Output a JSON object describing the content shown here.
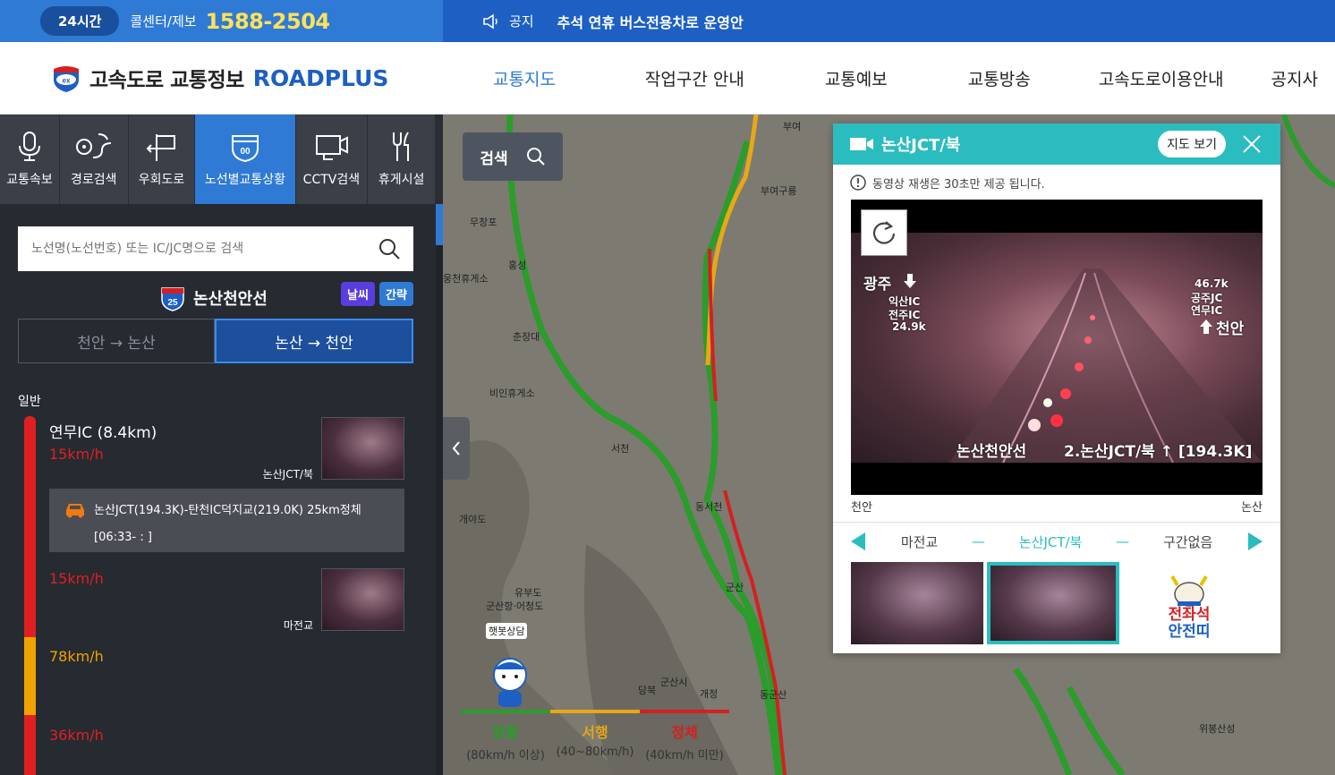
{
  "topbar": {
    "badge": "24시간",
    "callcenter_label": "콜센터/제보",
    "phone": "1588-2504",
    "notice_label": "공지",
    "notice_text": "추석 연휴 버스전용차로 운영안"
  },
  "header": {
    "logo_text": "고속도로 교통정보",
    "logo_brand": "ROADPLUS",
    "logo_badge": "ex",
    "nav": [
      "교통지도",
      "작업구간 안내",
      "교통예보",
      "교통방송",
      "고속도로이용안내",
      "공지사"
    ],
    "active_nav": "교통지도",
    "colors": {
      "brand": "#1d5fc3",
      "accent": "#2f7ad4",
      "teal": "#2bbcc0"
    }
  },
  "sidebar": {
    "icons": [
      {
        "label": "교통속보",
        "icon": "microphone-icon"
      },
      {
        "label": "경로검색",
        "icon": "route-icon"
      },
      {
        "label": "우회도로",
        "icon": "detour-icon"
      },
      {
        "label": "노선별교통상황",
        "icon": "highway-shield-icon",
        "active": true
      },
      {
        "label": "CCTV검색",
        "icon": "cctv-icon"
      },
      {
        "label": "휴게시설",
        "icon": "restaurant-icon"
      }
    ],
    "search_placeholder": "노선명(노선번호) 또는 IC/JC명으로 검색",
    "route_number": "25",
    "route_name": "논산천안선",
    "weather_chip": "날씨",
    "brief_chip": "간략",
    "directions": [
      "천안 → 논산",
      "논산 → 천안"
    ],
    "active_direction": "논산 → 천안",
    "section_label": "일반",
    "segments": [
      {
        "ic": "연무IC (8.4km)",
        "speed": "15km/h",
        "status": "congested",
        "cctv_label": "논산JCT/북"
      },
      {
        "ic": "",
        "speed": "15km/h",
        "status": "congested",
        "cctv_label": "마전교"
      },
      {
        "ic": "",
        "speed": "78km/h",
        "status": "slow",
        "cctv_label": ""
      },
      {
        "ic": "",
        "speed": "36km/h",
        "status": "congested",
        "cctv_label": ""
      }
    ],
    "incident": {
      "icon": "car-accident-icon",
      "text": "논산JCT(194.3K)-탄천IC덕지교(219.0K) 25km정체",
      "time": "[06:33- : ]"
    }
  },
  "map": {
    "search_label": "검색",
    "labels": [
      "부여",
      "부여구룡",
      "무창포",
      "웅천휴게소",
      "홍성",
      "춘장대",
      "비인휴게소",
      "서천",
      "동서천",
      "개야도",
      "유부도",
      "군산항·어청도",
      "군산",
      "동군산",
      "당북",
      "군산시",
      "개정",
      "햇봇상담",
      "천안",
      "위봉산성"
    ],
    "legend": [
      {
        "name": "원활",
        "range": "(80km/h 이상)",
        "color": "#2a9d2a"
      },
      {
        "name": "서행",
        "range": "(40~80km/h)",
        "color": "#e6a817"
      },
      {
        "name": "정체",
        "range": "(40km/h 미만)",
        "color": "#d42020"
      }
    ]
  },
  "cctv": {
    "title": "논산JCT/북",
    "map_button": "지도 보기",
    "note": "동영상 재생은 30초만 제공 됩니다.",
    "overlay": {
      "left_dest": "광주",
      "left_ic1": "익산IC",
      "left_ic2": "전주IC",
      "left_dist": "24.9k",
      "right_dist": "46.7k",
      "right_ic1": "공주JC",
      "right_ic2": "연무IC",
      "right_dest": "천안",
      "caption_route": "논산천안선",
      "caption_point": "2.논산JCT/북 ↑ [194.3K]"
    },
    "end_left": "천안",
    "end_right": "논산",
    "nav": {
      "prev": "마전교",
      "current": "논산JCT/북",
      "next": "구간없음",
      "sep": "—"
    },
    "banner_line1": "전좌석",
    "banner_line2": "안전띠"
  }
}
